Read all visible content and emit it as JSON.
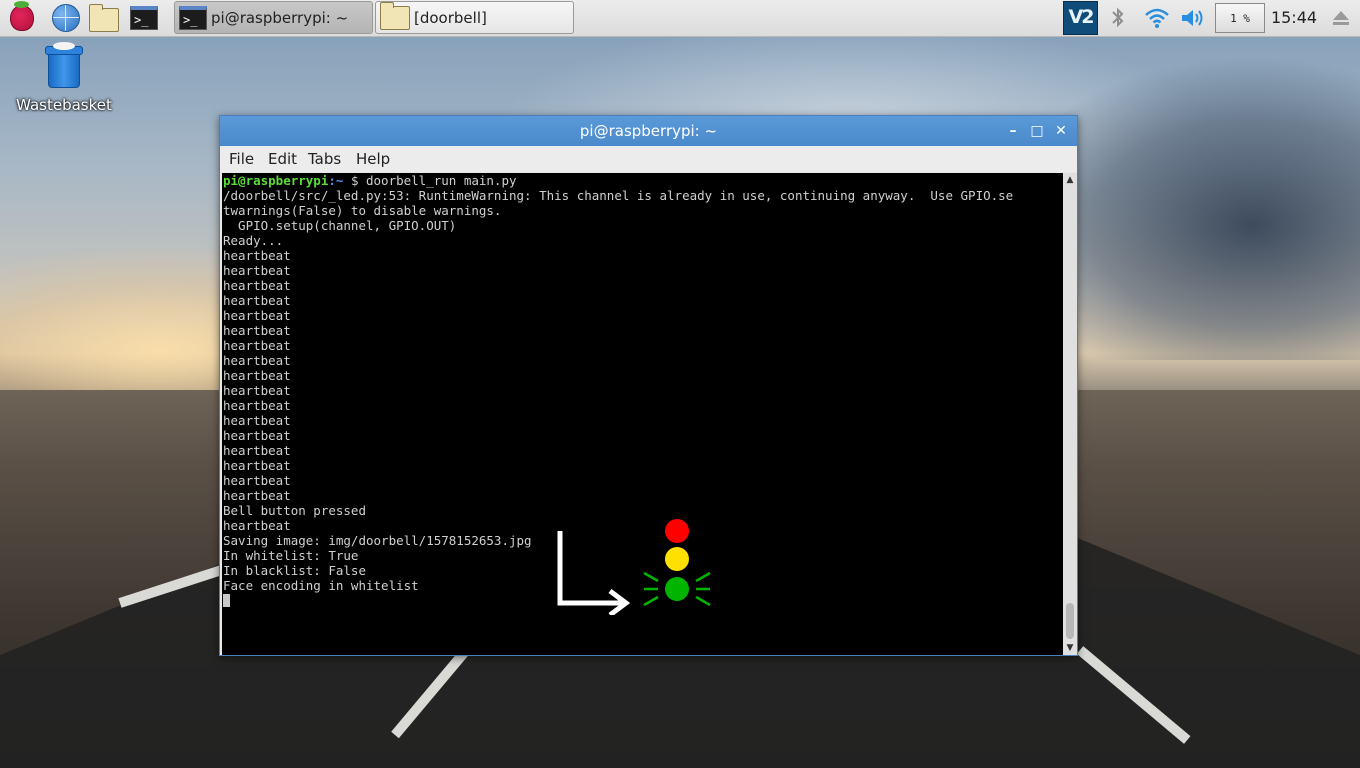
{
  "taskbar": {
    "apps": [
      {
        "name": "menu",
        "icon": "raspberry-icon"
      },
      {
        "name": "browser",
        "icon": "globe-icon"
      },
      {
        "name": "file-manager",
        "icon": "folder-icon"
      },
      {
        "name": "terminal",
        "icon": "terminal-icon"
      }
    ],
    "tasks": [
      {
        "label": "pi@raspberrypi: ~",
        "icon": "terminal-icon",
        "active": true
      },
      {
        "label": "[doorbell]",
        "icon": "folder-icon",
        "active": false
      }
    ],
    "tray": {
      "vnc_label": "V2",
      "cpu": "1 %",
      "clock": "15:44"
    }
  },
  "desktop": {
    "icons": [
      {
        "label": "Wastebasket",
        "icon": "wastebasket-icon"
      }
    ]
  },
  "window": {
    "title": "pi@raspberrypi: ~",
    "controls": {
      "minimize": "–",
      "maximize": "□",
      "close": "✕"
    },
    "menu": [
      "File",
      "Edit",
      "Tabs",
      "Help"
    ]
  },
  "terminal": {
    "prompt_user": "pi@raspberrypi",
    "prompt_path": ":~",
    "prompt_symbol": " $ ",
    "command": "doorbell_run main.py",
    "lines": [
      "/doorbell/src/_led.py:53: RuntimeWarning: This channel is already in use, continuing anyway.  Use GPIO.se",
      "twarnings(False) to disable warnings.",
      "  GPIO.setup(channel, GPIO.OUT)",
      "Ready...",
      "heartbeat",
      "heartbeat",
      "heartbeat",
      "heartbeat",
      "heartbeat",
      "heartbeat",
      "heartbeat",
      "heartbeat",
      "heartbeat",
      "heartbeat",
      "heartbeat",
      "heartbeat",
      "heartbeat",
      "heartbeat",
      "heartbeat",
      "heartbeat",
      "heartbeat",
      "Bell button pressed",
      "heartbeat",
      "Saving image: img/doorbell/1578152653.jpg",
      "In whitelist: True",
      "In blacklist: False",
      "Face encoding in whitelist"
    ]
  },
  "annotation": {
    "arrow_color": "#ffffff",
    "lights": [
      {
        "color": "#ff0000",
        "state": "off"
      },
      {
        "color": "#ffe000",
        "state": "off"
      },
      {
        "color": "#00b400",
        "state": "on"
      }
    ],
    "glow_color": "#00b400"
  }
}
